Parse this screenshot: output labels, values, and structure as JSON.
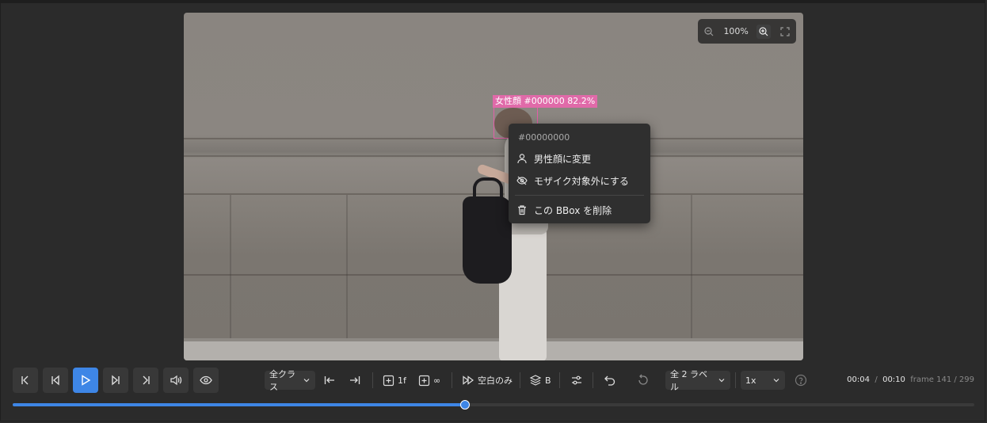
{
  "video": {
    "bbox_label": "女性顔 #000000 82.2%",
    "zoom_level": "100%"
  },
  "context_menu": {
    "header": "#00000000",
    "items": [
      {
        "label": "男性顔に変更",
        "icon": "person-icon"
      },
      {
        "label": "モザイク対象外にする",
        "icon": "eye-off-icon"
      },
      {
        "label": "この BBox を削除",
        "icon": "trash-icon"
      }
    ]
  },
  "toolbar": {
    "class_filter": "全クラス",
    "step_1f_label": "1f",
    "step_inf_label": "∞",
    "blank_only_label": "空白のみ",
    "layer_label": "B",
    "label_filter": "全 2 ラベル",
    "speed": "1x"
  },
  "time": {
    "current": "00:04",
    "separator": "/",
    "total": "00:10",
    "frame_text": "frame 141 / 299"
  },
  "progress": {
    "value": 0.47
  },
  "colors": {
    "accent": "#3e86e6",
    "bbox": "#e25fa8",
    "background": "#2b2b2b"
  }
}
